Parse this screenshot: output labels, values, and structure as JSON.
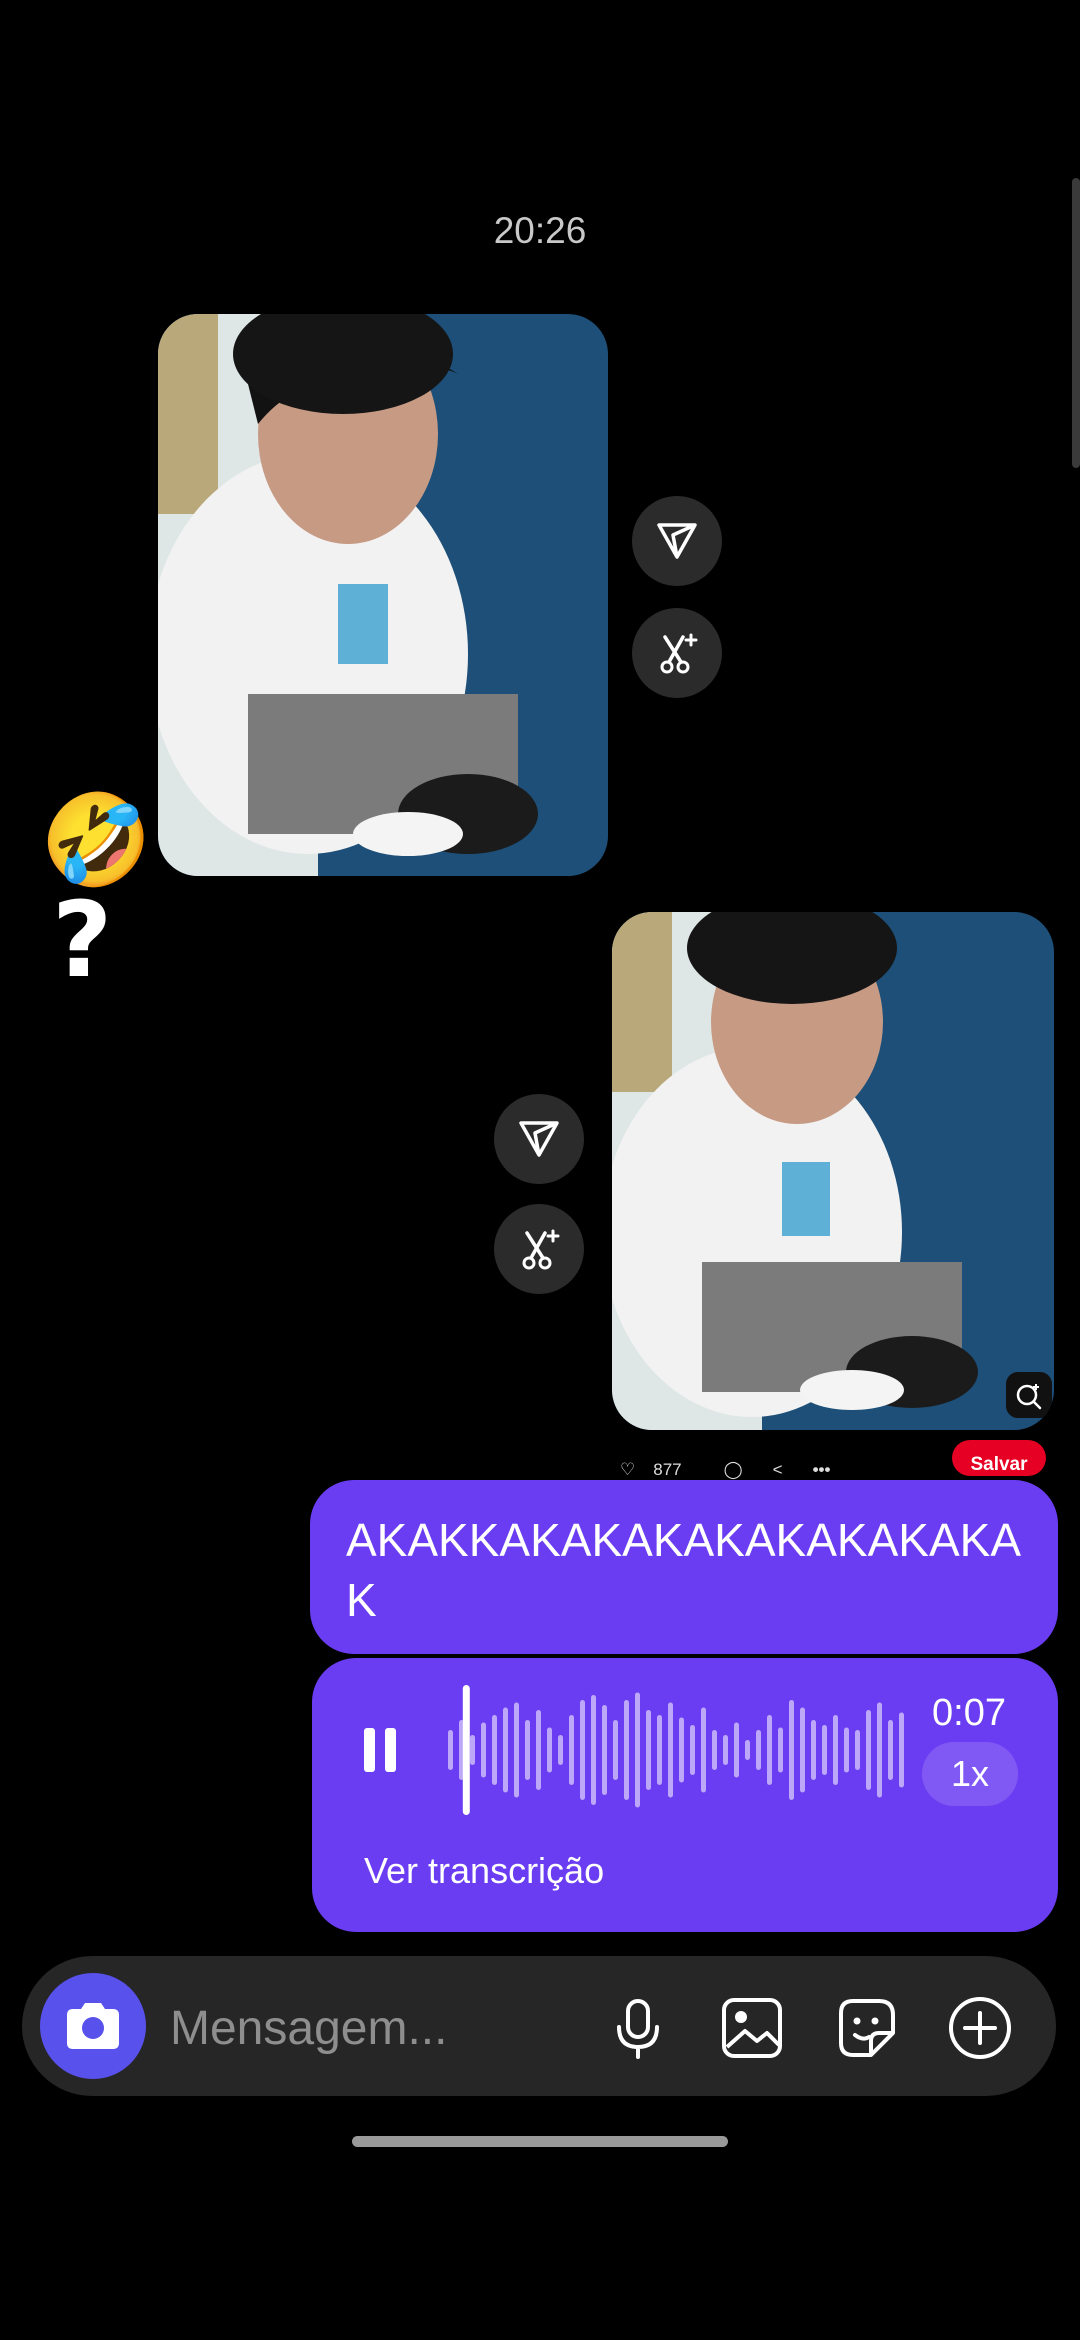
{
  "thread": {
    "timestamp": "20:26"
  },
  "reaction": {
    "emoji": "🤣",
    "text": "?"
  },
  "post": {
    "likes": "877",
    "save_label": "Salvar"
  },
  "messages": {
    "text_message": "AKAKKAKAKAKAKAKAKAKAKAK",
    "audio": {
      "duration": "0:07",
      "speed": "1x",
      "transcript_link": "Ver transcrição",
      "progress": 0.02
    }
  },
  "composer": {
    "placeholder": "Mensagem..."
  },
  "icons": {
    "share": "share-icon",
    "remix": "remix-icon",
    "camera": "camera-icon",
    "mic": "microphone-icon",
    "gallery": "gallery-icon",
    "sticker": "sticker-icon",
    "add": "plus-circle-icon",
    "lens": "lens-search-icon"
  },
  "colors": {
    "bubble": "#6a3df2",
    "camera_button": "#5851ec",
    "save_button": "#e60023"
  }
}
